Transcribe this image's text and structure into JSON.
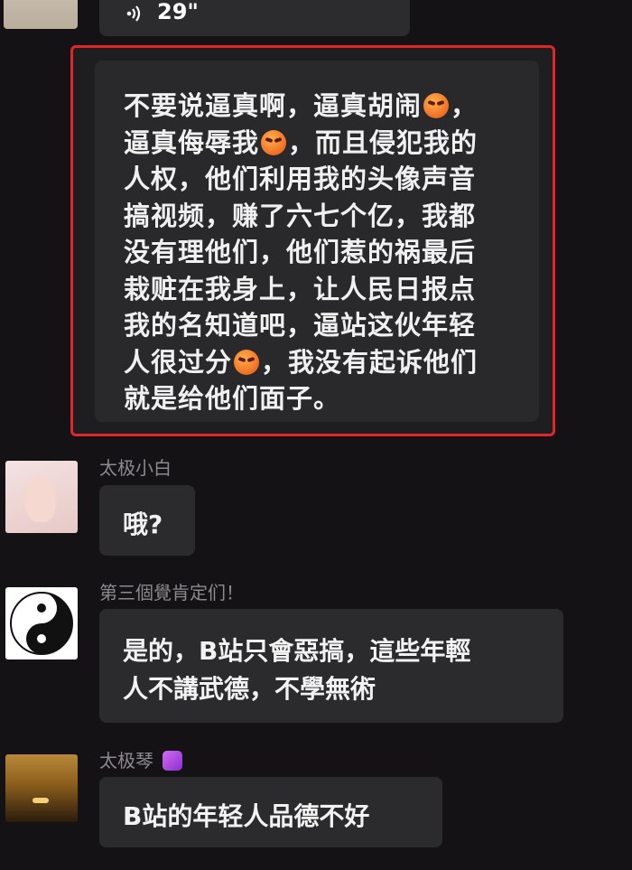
{
  "voice": {
    "duration": "29\""
  },
  "highlight": {
    "lines": [
      [
        "不要说逼真啊，逼真胡闹",
        "emoji",
        "，"
      ],
      [
        "逼真侮辱我",
        "emoji",
        "，而且侵犯我的"
      ],
      [
        "人权，他们利用我的头像声音"
      ],
      [
        "搞视频，赚了六七个亿，我都"
      ],
      [
        "没有理他们，他们惹的祸最后"
      ],
      [
        "栽赃在我身上，让人民日报点"
      ],
      [
        "我的名知道吧，逼站这伙年轻"
      ],
      [
        "人很过分",
        "emoji",
        "，我没有起诉他们"
      ],
      [
        "就是给他们面子。"
      ]
    ],
    "border_color": "#e0262a"
  },
  "messages": [
    {
      "sender": "太极小白",
      "text": "哦?"
    },
    {
      "sender": "第三個覺肯定们！",
      "lines": [
        "是的，B站只會惡搞，這些年輕",
        "人不講武德，不學無術"
      ]
    },
    {
      "sender": "太极琴",
      "text": "B站的年轻人品德不好"
    }
  ],
  "emoji_name": "angry-face-emoji"
}
